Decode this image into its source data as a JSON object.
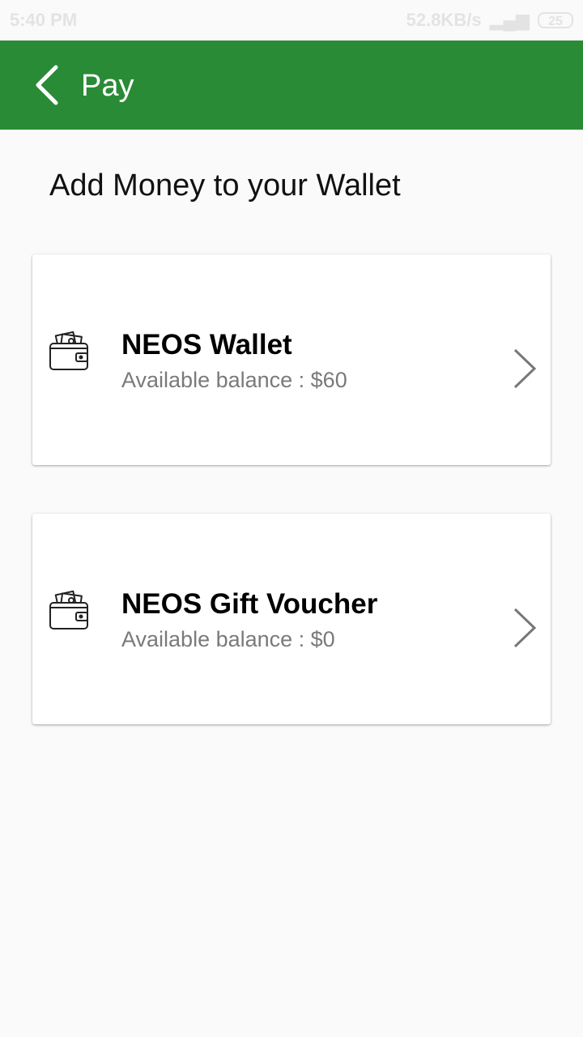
{
  "status_bar": {
    "time": "5:40 PM",
    "speed": "52.8KB/s",
    "battery": "25"
  },
  "app_bar": {
    "title": "Pay",
    "back_icon": "chevron-left-icon"
  },
  "section": {
    "title": "Add Money to your Wallet"
  },
  "wallet_options": [
    {
      "name": "NEOS Wallet",
      "balance_label": "Available balance : $60",
      "icon": "wallet-icon"
    },
    {
      "name": "NEOS Gift Voucher",
      "balance_label": "Available balance : $0",
      "icon": "wallet-icon"
    }
  ],
  "colors": {
    "primary": "#2a8b37",
    "background": "#fafafa",
    "subtext": "#7a7a7a"
  }
}
